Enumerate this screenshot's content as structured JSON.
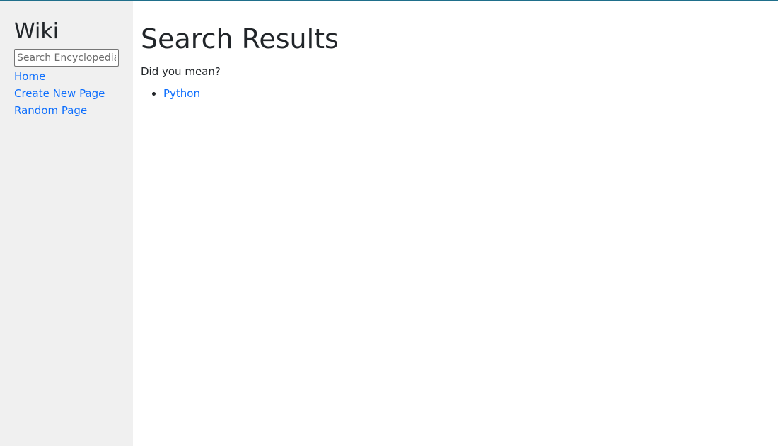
{
  "theme": {
    "sidebar_bg": "#f0f0f0",
    "link_color": "#0d6efd",
    "top_border_color": "#1f6f8b"
  },
  "sidebar": {
    "title": "Wiki",
    "search": {
      "placeholder": "Search Encyclopedia",
      "value": ""
    },
    "links": [
      {
        "label": "Home"
      },
      {
        "label": "Create New Page"
      },
      {
        "label": "Random Page"
      }
    ]
  },
  "main": {
    "heading": "Search Results",
    "prompt": "Did you mean?",
    "results": [
      {
        "label": "Python"
      }
    ]
  }
}
